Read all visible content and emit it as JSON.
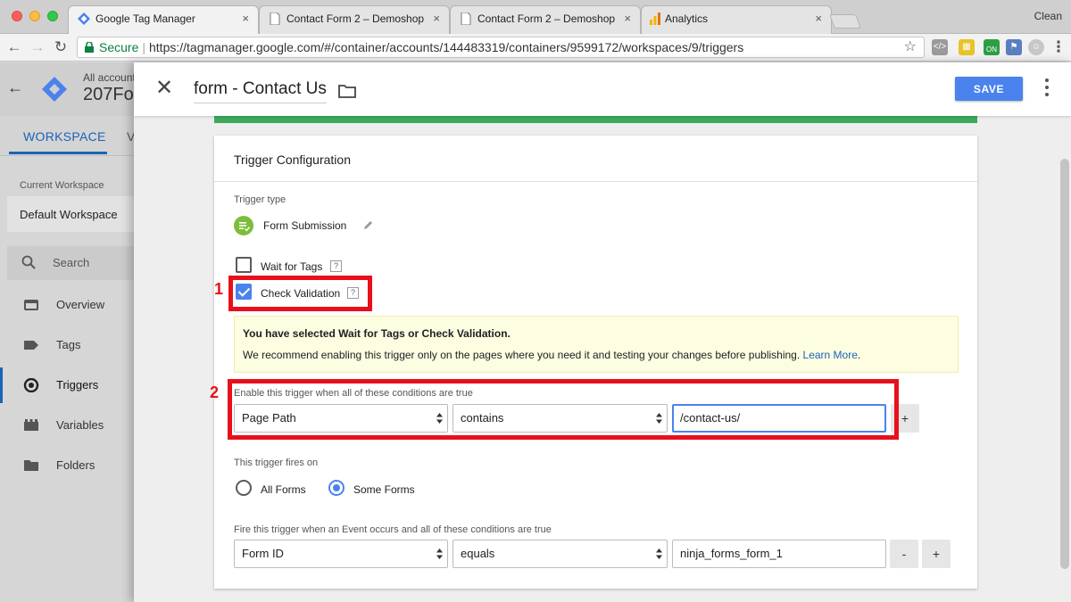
{
  "browser": {
    "tabs": [
      {
        "title": "Google Tag Manager",
        "close": "×"
      },
      {
        "title": "Contact Form 2 – Demoshop",
        "close": "×"
      },
      {
        "title": "Contact Form 2 – Demoshop",
        "close": "×"
      },
      {
        "title": "Analytics",
        "close": "×"
      }
    ],
    "profile_label": "Clean",
    "secure_label": "Secure",
    "url": "https://tagmanager.google.com/#/container/accounts/144483319/containers/9599172/workspaces/9/triggers",
    "extension_on_badge": "ON",
    "colors": {
      "secure_green": "#0b8043",
      "close_red": "#fc605c",
      "min_yellow": "#fdbc40",
      "max_green": "#34c84a"
    }
  },
  "gtm": {
    "account_label": "All account",
    "container_name": "207Fo",
    "tab_workspace": "WORKSPACE",
    "tab_versions_partial": "V",
    "current_workspace_label": "Current Workspace",
    "workspace_name": "Default Workspace",
    "search_placeholder": "Search",
    "nav": [
      {
        "label": "Overview",
        "icon": "overview-icon"
      },
      {
        "label": "Tags",
        "icon": "tag-icon"
      },
      {
        "label": "Triggers",
        "icon": "trigger-icon",
        "active": true
      },
      {
        "label": "Variables",
        "icon": "variables-icon"
      },
      {
        "label": "Folders",
        "icon": "folder-icon"
      }
    ],
    "accent": "#1a63b8"
  },
  "panel": {
    "trigger_name": "form - Contact Us",
    "save_label": "SAVE",
    "card_title": "Trigger Configuration",
    "trigger_type_label": "Trigger type",
    "trigger_type": "Form Submission",
    "wait_for_tags": {
      "label": "Wait for Tags",
      "checked": false,
      "help": "?"
    },
    "check_validation": {
      "label": "Check Validation",
      "checked": true,
      "help": "?"
    },
    "warning": {
      "title": "You have selected Wait for Tags or Check Validation.",
      "body": "We recommend enabling this trigger only on the pages where you need it and testing your changes before publishing.",
      "link": "Learn More",
      "after_link": "."
    },
    "enable_conditions_label": "Enable this trigger when all of these conditions are true",
    "enable_condition": {
      "variable": "Page Path",
      "operator": "contains",
      "value": "/contact-us/",
      "add": "+"
    },
    "fires_on_label": "This trigger fires on",
    "fires_on_options": [
      {
        "label": "All Forms",
        "selected": false
      },
      {
        "label": "Some Forms",
        "selected": true
      }
    ],
    "fire_conditions_label": "Fire this trigger when an Event occurs and all of these conditions are true",
    "fire_condition": {
      "variable": "Form ID",
      "operator": "equals",
      "value": "ninja_forms_form_1",
      "remove": "-",
      "add": "+"
    },
    "save_color": "#4a82ee",
    "success_strip_color": "#3da95d"
  },
  "annotations": {
    "marker_1": "1",
    "marker_2": "2",
    "color": "#e8101a"
  }
}
